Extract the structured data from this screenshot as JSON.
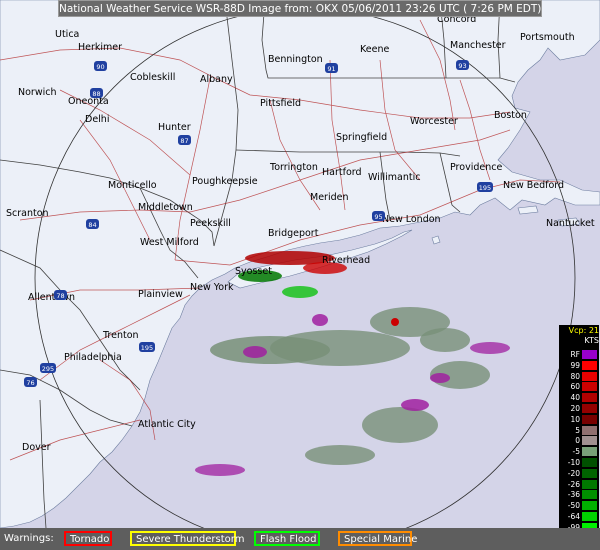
{
  "title": "National Weather Service WSR-88D Image from: OKX 05/06/2011 23:26 UTC ( 7:26 PM EDT)",
  "warnings": {
    "label": "Warnings:",
    "items": [
      {
        "id": "tornado",
        "label": "Tornado",
        "color": "#ff0000"
      },
      {
        "id": "svr",
        "label": "Severe Thunderstorm",
        "color": "#ffff00"
      },
      {
        "id": "flood",
        "label": "Flash Flood",
        "color": "#00ff00"
      },
      {
        "id": "marine",
        "label": "Special Marine",
        "color": "#ff8c00"
      }
    ]
  },
  "legend": {
    "title": "Vcp: 21",
    "units": "KTS",
    "entries": [
      {
        "label": "RF",
        "color": "#9900cc"
      },
      {
        "label": "99",
        "color": "#ff0000"
      },
      {
        "label": "80",
        "color": "#e80000"
      },
      {
        "label": "60",
        "color": "#cc0000"
      },
      {
        "label": "40",
        "color": "#b00000"
      },
      {
        "label": "20",
        "color": "#940000"
      },
      {
        "label": "10",
        "color": "#780000"
      },
      {
        "label": "5",
        "color": "#907070"
      },
      {
        "label": "0",
        "color": "#a09090"
      },
      {
        "label": "-5",
        "color": "#78a078"
      },
      {
        "label": "-10",
        "color": "#005000"
      },
      {
        "label": "-20",
        "color": "#006400"
      },
      {
        "label": "-26",
        "color": "#007800"
      },
      {
        "label": "-36",
        "color": "#009000"
      },
      {
        "label": "-50",
        "color": "#00b000"
      },
      {
        "label": "-64",
        "color": "#00d000"
      },
      {
        "label": "-99",
        "color": "#00f000"
      },
      {
        "label": "ND",
        "color": "#000000"
      }
    ]
  },
  "places": [
    {
      "name": "Utica"
    },
    {
      "name": "Herkimer"
    },
    {
      "name": "Norwich"
    },
    {
      "name": "Oneonta"
    },
    {
      "name": "Cobleskill"
    },
    {
      "name": "Albany"
    },
    {
      "name": "Delhi"
    },
    {
      "name": "Hunter"
    },
    {
      "name": "Bennington"
    },
    {
      "name": "Keene"
    },
    {
      "name": "Concord"
    },
    {
      "name": "Manchester"
    },
    {
      "name": "Portsmouth"
    },
    {
      "name": "Pittsfield"
    },
    {
      "name": "Worcester"
    },
    {
      "name": "Boston"
    },
    {
      "name": "Springfield"
    },
    {
      "name": "Torrington"
    },
    {
      "name": "Hartford"
    },
    {
      "name": "Willimantic"
    },
    {
      "name": "Providence"
    },
    {
      "name": "New Bedford"
    },
    {
      "name": "Monticello"
    },
    {
      "name": "Poughkeepsie"
    },
    {
      "name": "Meriden"
    },
    {
      "name": "New London"
    },
    {
      "name": "Nantucket"
    },
    {
      "name": "Scranton"
    },
    {
      "name": "Middletown"
    },
    {
      "name": "Peekskill"
    },
    {
      "name": "Bridgeport"
    },
    {
      "name": "West Milford"
    },
    {
      "name": "Riverhead"
    },
    {
      "name": "Syosset"
    },
    {
      "name": "New York"
    },
    {
      "name": "Plainview"
    },
    {
      "name": "Allentown"
    },
    {
      "name": "Trenton"
    },
    {
      "name": "Philadelphia"
    },
    {
      "name": "Atlantic City"
    },
    {
      "name": "Dover"
    }
  ],
  "highways": [
    {
      "label": "90"
    },
    {
      "label": "88"
    },
    {
      "label": "87"
    },
    {
      "label": "91"
    },
    {
      "label": "93"
    },
    {
      "label": "84"
    },
    {
      "label": "95"
    },
    {
      "label": "195"
    },
    {
      "label": "78"
    },
    {
      "label": "195"
    },
    {
      "label": "295"
    },
    {
      "label": "76"
    }
  ]
}
